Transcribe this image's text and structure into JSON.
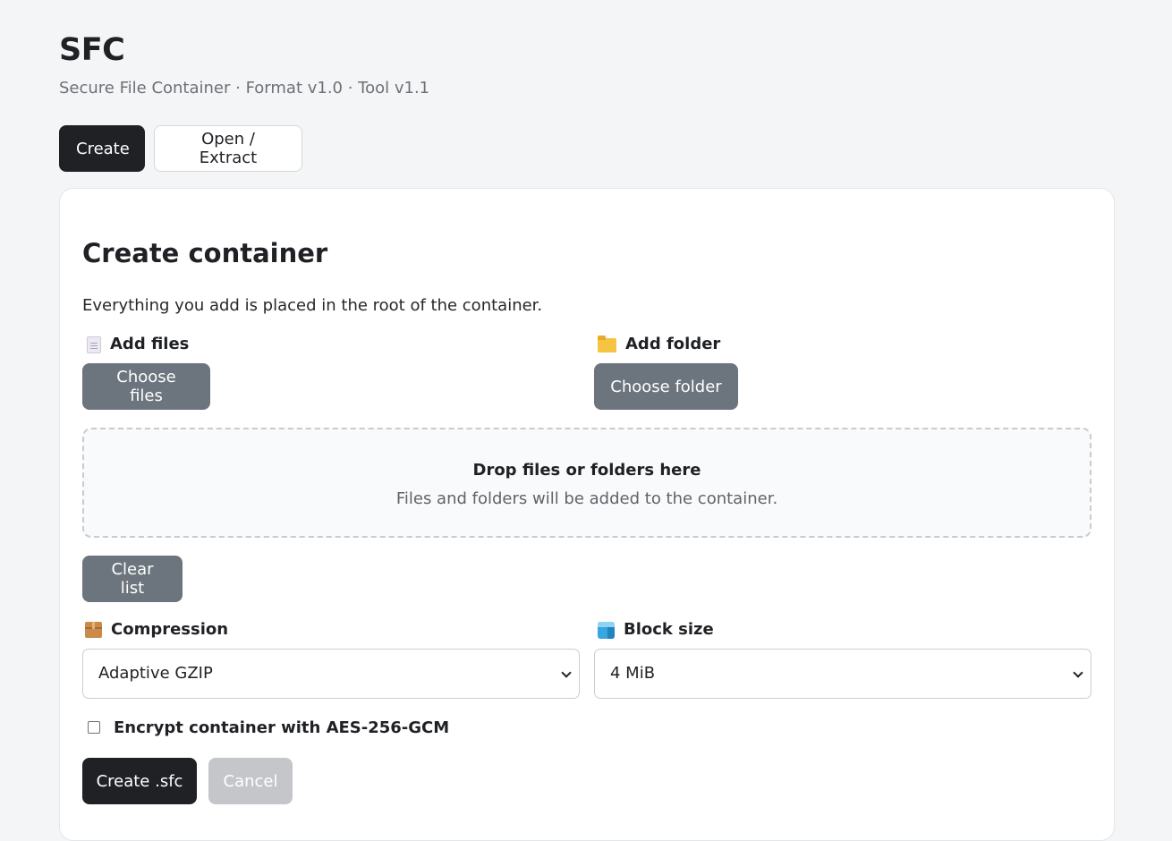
{
  "app": {
    "title": "SFC",
    "subtitle": "Secure File Container · Format v1.0 · Tool v1.1"
  },
  "tabs": [
    {
      "label": "Create",
      "active": true
    },
    {
      "label": "Open / Extract",
      "active": false
    }
  ],
  "create": {
    "title": "Create container",
    "description": "Everything you add is placed in the root of the container.",
    "add_files": {
      "label": "Add files",
      "icon": "document-icon",
      "button": "Choose files"
    },
    "add_folder": {
      "label": "Add folder",
      "icon": "folder-icon",
      "button": "Choose folder"
    },
    "dropzone": {
      "title": "Drop files or folders here",
      "subtitle": "Files and folders will be added to the container."
    },
    "clear_button": "Clear list",
    "compression": {
      "label": "Compression",
      "icon": "package-icon",
      "selected": "Adaptive GZIP"
    },
    "block_size": {
      "label": "Block size",
      "icon": "cube-icon",
      "selected": "4 MiB"
    },
    "encrypt": {
      "label": "Encrypt container with AES-256-GCM",
      "checked": false
    },
    "create_button": "Create .sfc",
    "cancel_button": "Cancel"
  },
  "colors": {
    "background": "#f4f5f7",
    "primary": "#1f2125",
    "secondary": "#6c757d",
    "disabled": "#c4c6c9"
  }
}
